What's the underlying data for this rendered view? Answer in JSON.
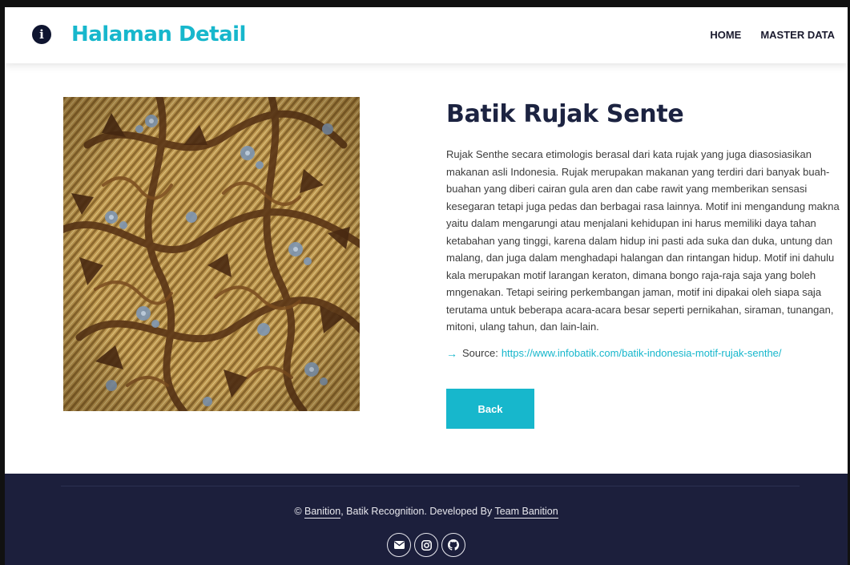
{
  "navbar": {
    "brand_icon_name": "info-circle-icon",
    "brand_title": "Halaman Detail",
    "menu": [
      {
        "label": "HOME"
      },
      {
        "label": "MASTER DATA"
      }
    ]
  },
  "detail": {
    "title": "Batik Rujak Sente",
    "description": "Rujak Senthe secara etimologis berasal dari kata rujak yang juga diasosiasikan makanan asli Indonesia. Rujak merupakan makanan yang terdiri dari banyak buah-buahan yang diberi cairan gula aren dan cabe rawit yang memberikan sensasi kesegaran tetapi juga pedas dan berbagai rasa lainnya. Motif ini mengandung makna yaitu dalam mengarungi atau menjalani kehidupan ini harus memiliki daya tahan ketabahan yang tinggi, karena dalam hidup ini pasti ada suka dan duka, untung dan malang, dan juga dalam menghadapi halangan dan rintangan hidup. Motif ini dahulu kala merupakan motif larangan keraton, dimana bongo raja-raja saja yang boleh mngenakan. Tetapi seiring perkembangan jaman, motif ini dipakai oleh siapa saja terutama untuk beberapa acara-acara besar seperti pernikahan, siraman, tunangan, mitoni, ulang tahun, dan lain-lain.",
    "source_label": "Source:",
    "source_url": "https://www.infobatik.com/batik-indonesia-motif-rujak-senthe/",
    "back_label": "Back"
  },
  "footer": {
    "copyright_prefix": "©",
    "brand_link": "Banition",
    "middle_text": ", Batik Recognition. Developed By",
    "team_link": "Team Banition",
    "social_icons": [
      "envelope-icon",
      "instagram-icon",
      "github-icon"
    ]
  },
  "colors": {
    "accent": "#17b7cc",
    "footer_bg": "#1c1f3c",
    "title": "#1c2341"
  }
}
